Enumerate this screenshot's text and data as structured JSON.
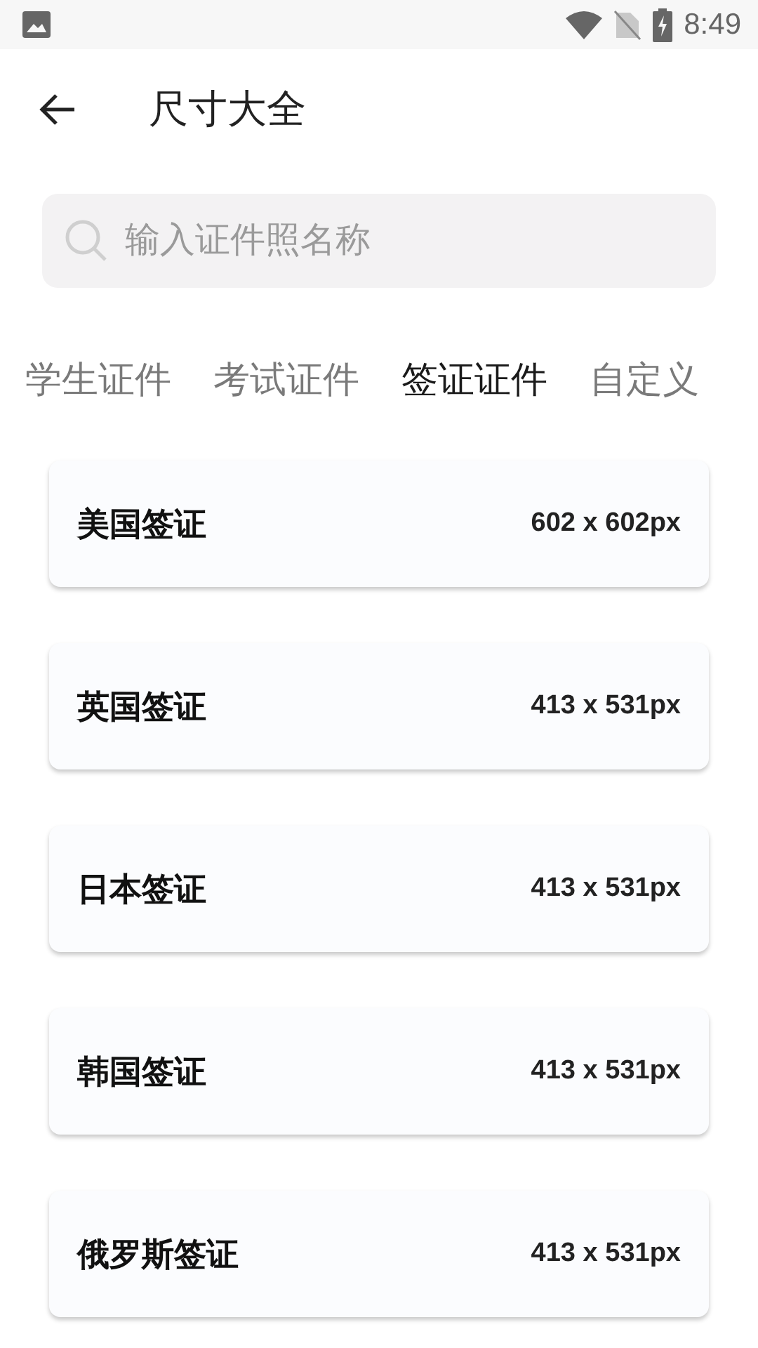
{
  "status_bar": {
    "time": "8:49"
  },
  "app_bar": {
    "title": "尺寸大全"
  },
  "search": {
    "placeholder": "输入证件照名称"
  },
  "tabs": [
    {
      "label": "学生证件",
      "selected": false
    },
    {
      "label": "考试证件",
      "selected": false
    },
    {
      "label": "签证证件",
      "selected": true
    },
    {
      "label": "自定义",
      "selected": false
    }
  ],
  "items": [
    {
      "name": "美国签证",
      "size": "602 x 602px"
    },
    {
      "name": "英国签证",
      "size": "413 x 531px"
    },
    {
      "name": "日本签证",
      "size": "413 x 531px"
    },
    {
      "name": "韩国签证",
      "size": "413 x 531px"
    },
    {
      "name": "俄罗斯签证",
      "size": "413 x 531px"
    }
  ]
}
